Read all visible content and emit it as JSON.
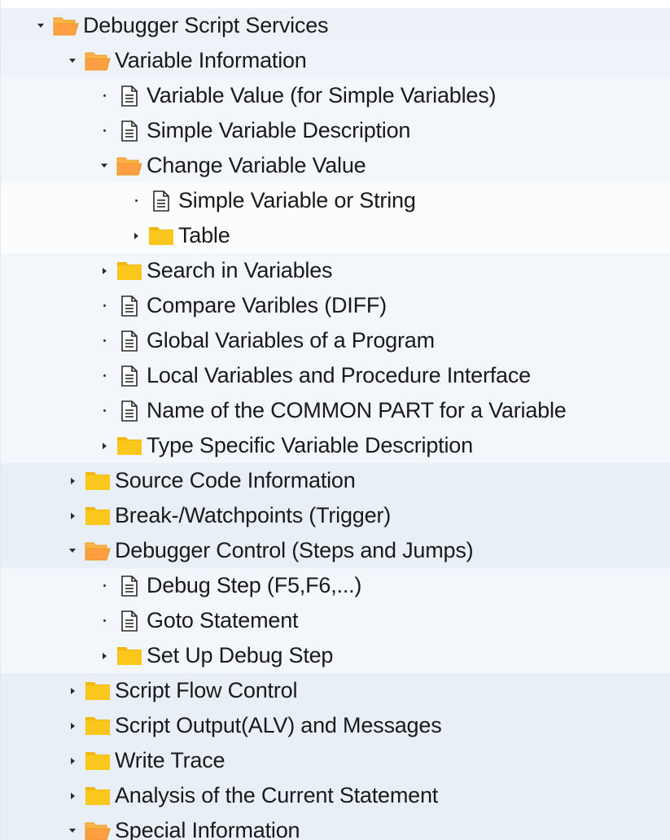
{
  "tree": {
    "rows": [
      {
        "label": "Debugger Script Services",
        "level": 0,
        "kind": "folder",
        "state": "expanded",
        "bg": "#edf2f8",
        "icon": "folder-open-icon"
      },
      {
        "label": "Variable Information",
        "level": 1,
        "kind": "folder",
        "state": "expanded",
        "bg": "#eef3f9",
        "icon": "folder-open-icon"
      },
      {
        "label": "Variable Value (for Simple Variables)",
        "level": 2,
        "kind": "document",
        "state": "leaf",
        "bg": "#f3f6fb",
        "icon": "document-icon"
      },
      {
        "label": "Simple Variable Description",
        "level": 2,
        "kind": "document",
        "state": "leaf",
        "bg": "#f3f6fb",
        "icon": "document-icon"
      },
      {
        "label": "Change Variable Value",
        "level": 2,
        "kind": "folder",
        "state": "expanded",
        "bg": "#f3f6fb",
        "icon": "folder-open-icon"
      },
      {
        "label": "Simple Variable or String",
        "level": 3,
        "kind": "document",
        "state": "leaf",
        "bg": "#fbfcfe",
        "icon": "document-icon"
      },
      {
        "label": "Table",
        "level": 3,
        "kind": "folder",
        "state": "collapsed",
        "bg": "#fbfcfe",
        "icon": "folder-closed-icon"
      },
      {
        "label": "Search in Variables",
        "level": 2,
        "kind": "folder",
        "state": "collapsed",
        "bg": "#f3f6fb",
        "icon": "folder-closed-icon"
      },
      {
        "label": "Compare Varibles (DIFF)",
        "level": 2,
        "kind": "document",
        "state": "leaf",
        "bg": "#f3f6fb",
        "icon": "document-icon"
      },
      {
        "label": "Global Variables of a Program",
        "level": 2,
        "kind": "document",
        "state": "leaf",
        "bg": "#f3f6fb",
        "icon": "document-icon"
      },
      {
        "label": "Local Variables and Procedure Interface",
        "level": 2,
        "kind": "document",
        "state": "leaf",
        "bg": "#f3f6fb",
        "icon": "document-icon"
      },
      {
        "label": "Name of the COMMON PART for a Variable",
        "level": 2,
        "kind": "document",
        "state": "leaf",
        "bg": "#f3f6fb",
        "icon": "document-icon"
      },
      {
        "label": "Type Specific Variable Description",
        "level": 2,
        "kind": "folder",
        "state": "collapsed",
        "bg": "#f3f6fb",
        "icon": "folder-closed-icon"
      },
      {
        "label": "Source Code Information",
        "level": 1,
        "kind": "folder",
        "state": "collapsed",
        "bg": "#e9eff7",
        "icon": "folder-closed-icon"
      },
      {
        "label": "Break-/Watchpoints (Trigger)",
        "level": 1,
        "kind": "folder",
        "state": "collapsed",
        "bg": "#e9eff7",
        "icon": "folder-closed-icon"
      },
      {
        "label": "Debugger Control (Steps and Jumps)",
        "level": 1,
        "kind": "folder",
        "state": "expanded",
        "bg": "#e9eff7",
        "icon": "folder-open-icon"
      },
      {
        "label": "Debug Step (F5,F6,...)",
        "level": 2,
        "kind": "document",
        "state": "leaf",
        "bg": "#f3f6fb",
        "icon": "document-icon"
      },
      {
        "label": "Goto Statement",
        "level": 2,
        "kind": "document",
        "state": "leaf",
        "bg": "#f3f6fb",
        "icon": "document-icon"
      },
      {
        "label": "Set Up Debug Step",
        "level": 2,
        "kind": "folder",
        "state": "collapsed",
        "bg": "#f3f6fb",
        "icon": "folder-closed-icon"
      },
      {
        "label": "Script Flow Control",
        "level": 1,
        "kind": "folder",
        "state": "collapsed",
        "bg": "#e9eff7",
        "icon": "folder-closed-icon"
      },
      {
        "label": "Script Output(ALV) and Messages",
        "level": 1,
        "kind": "folder",
        "state": "collapsed",
        "bg": "#e9eff7",
        "icon": "folder-closed-icon"
      },
      {
        "label": "Write Trace",
        "level": 1,
        "kind": "folder",
        "state": "collapsed",
        "bg": "#e9eff7",
        "icon": "folder-closed-icon"
      },
      {
        "label": "Analysis of the Current Statement",
        "level": 1,
        "kind": "folder",
        "state": "collapsed",
        "bg": "#e9eff7",
        "icon": "folder-closed-icon"
      },
      {
        "label": "Special Information",
        "level": 1,
        "kind": "folder",
        "state": "expanded",
        "bg": "#e9eff7",
        "icon": "folder-open-icon"
      }
    ]
  },
  "colors": {
    "folder_fill": "#fcc71c",
    "folder_tab": "#f2b60f",
    "folder_open_back": "#ffb34c",
    "folder_open_front": "#ff9e42",
    "folder_outline": "#e79b18",
    "text": "#1a1a1a"
  }
}
